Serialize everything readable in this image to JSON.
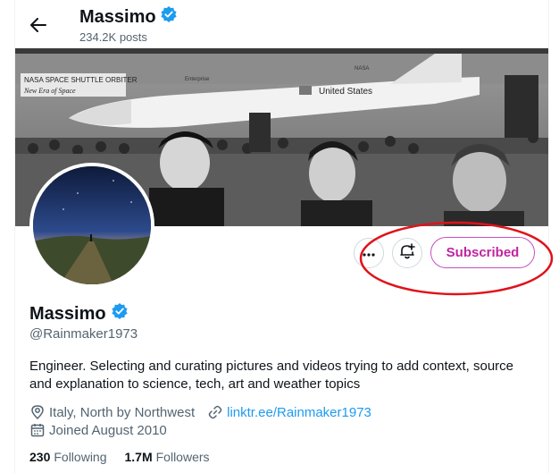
{
  "header": {
    "name": "Massimo",
    "posts": "234.2K posts"
  },
  "profile": {
    "name": "Massimo",
    "handle": "@Rainmaker1973",
    "bio": "Engineer. Selecting and curating pictures and videos trying to add context, source and explanation to science, tech, art and weather topics",
    "location": "Italy, North by Northwest",
    "website": "linktr.ee/Rainmaker1973",
    "joined": "Joined August 2010",
    "following_count": "230",
    "following_label": "Following",
    "followers_count": "1.7M",
    "followers_label": "Followers"
  },
  "actions": {
    "subscribed_label": "Subscribed"
  },
  "banner": {
    "sign_text": "NASA SPACE SHUTTLE ORBITER",
    "sign_text_2": "New Era of Space",
    "orbiter_name": "Enterprise",
    "tail_text": "United States",
    "tail_logo": "NASA"
  },
  "colors": {
    "verified": "#1d9bf0",
    "subscribed": "#c0259f",
    "annotation": "#e0121a",
    "link": "#1d9bf0"
  },
  "icons": [
    "back-arrow-icon",
    "verified-badge-icon",
    "more-icon",
    "notification-bell-icon",
    "location-icon",
    "link-icon",
    "calendar-icon"
  ]
}
